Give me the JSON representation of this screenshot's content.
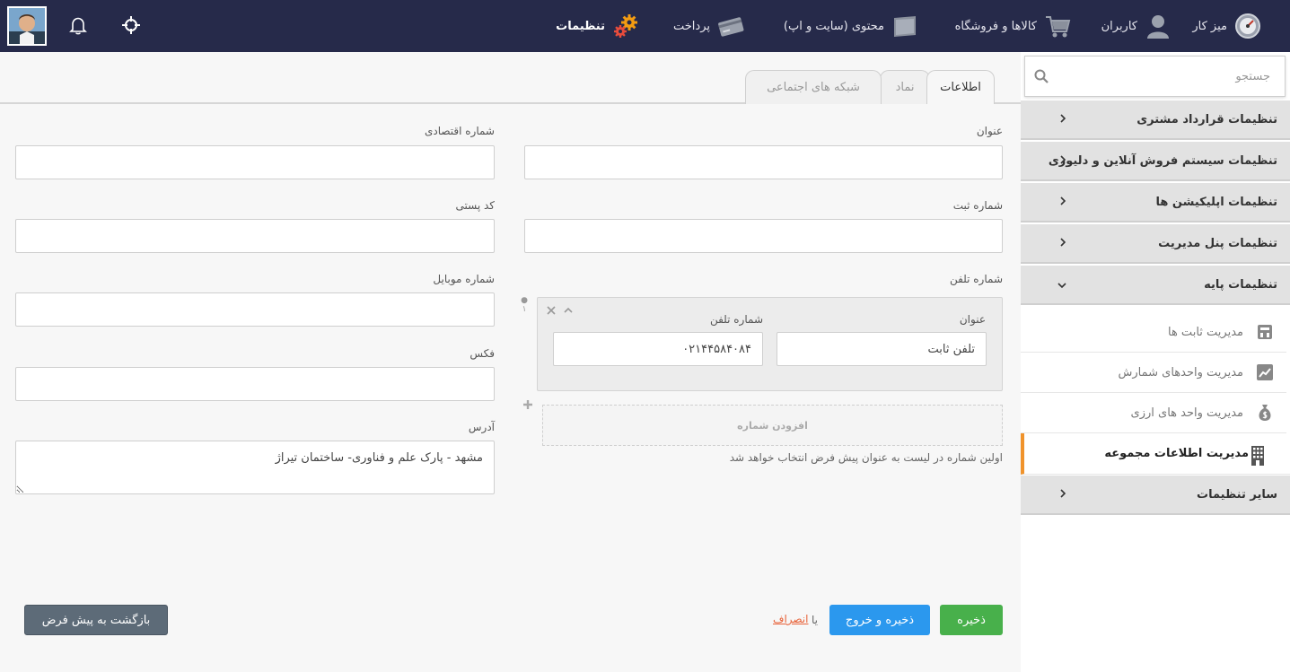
{
  "topbar": {
    "nav": [
      {
        "label": "میز کار",
        "icon": "dashboard-gauge-icon"
      },
      {
        "label": "کاربران",
        "icon": "user-icon"
      },
      {
        "label": "کالاها و فروشگاه",
        "icon": "shopping-cart-icon"
      },
      {
        "label": "محتوی (سایت و اپ)",
        "icon": "folder-icon"
      },
      {
        "label": "پرداخت",
        "icon": "credit-card-icon"
      },
      {
        "label": "تنظیمات",
        "icon": "gears-icon"
      }
    ],
    "icons": [
      "crosshair-icon",
      "bell-icon",
      "avatar"
    ]
  },
  "sidebar": {
    "search_placeholder": "جستجو",
    "menu": [
      {
        "label": "تنظیمات قرارداد مشتری",
        "expanded": false
      },
      {
        "label": "تنظیمات سیستم فروش آنلاین و دلیوری",
        "expanded": false
      },
      {
        "label": "تنظیمات اپلیکیشن ها",
        "expanded": false
      },
      {
        "label": "تنظیمات پنل مدیریت",
        "expanded": false
      },
      {
        "label": "تنظیمات پایه",
        "expanded": true
      },
      {
        "label": "سایر تنظیمات",
        "expanded": false
      }
    ],
    "submenu": [
      {
        "label": "مدیریت ثابت ها",
        "icon": "storage-icon"
      },
      {
        "label": "مدیریت واحدهای شمارش",
        "icon": "chart-icon"
      },
      {
        "label": "مدیریت واحد های ارزی",
        "icon": "money-bag-icon"
      },
      {
        "label": "مدیریت اطلاعات مجموعه",
        "icon": "building-icon",
        "active": true
      }
    ]
  },
  "tabs": [
    "اطلاعات",
    "نماد",
    "شبکه های اجتماعی"
  ],
  "form": {
    "title_label": "عنوان",
    "title_value": "",
    "economic_label": "شماره اقتصادی",
    "economic_value": "",
    "reg_label": "شماره ثبت",
    "reg_value": "",
    "postal_label": "کد پستی",
    "postal_value": "",
    "phone_label": "شماره تلفن",
    "mobile_label": "شماره موبایل",
    "mobile_value": "",
    "fax_label": "فکس",
    "fax_value": "",
    "address_label": "آدرس",
    "address_value": "مشهد - پارک علم و فناوری- ساختمان تیراژ",
    "phone_entry": {
      "index": "۱",
      "title_label": "عنوان",
      "title_value": "تلفن ثابت",
      "number_label": "شماره تلفن",
      "number_value": "۰۲۱۴۴۵۸۴۰۸۴"
    },
    "add_phone": "افزودن شماره",
    "hint": "اولین شماره در لیست به عنوان پیش فرض انتخاب خواهد شد"
  },
  "actions": {
    "save": "ذخیره",
    "save_exit": "ذخیره و خروج",
    "or": "یا",
    "cancel": "انصراف",
    "reset": "بازگشت به پیش فرض"
  },
  "colors": {
    "topbar": "#262a4a",
    "save": "#48b04b",
    "save_exit": "#2b98ee",
    "reset": "#5d6b78",
    "active_accent": "#f0932b",
    "cancel_link": "#e8633a"
  }
}
